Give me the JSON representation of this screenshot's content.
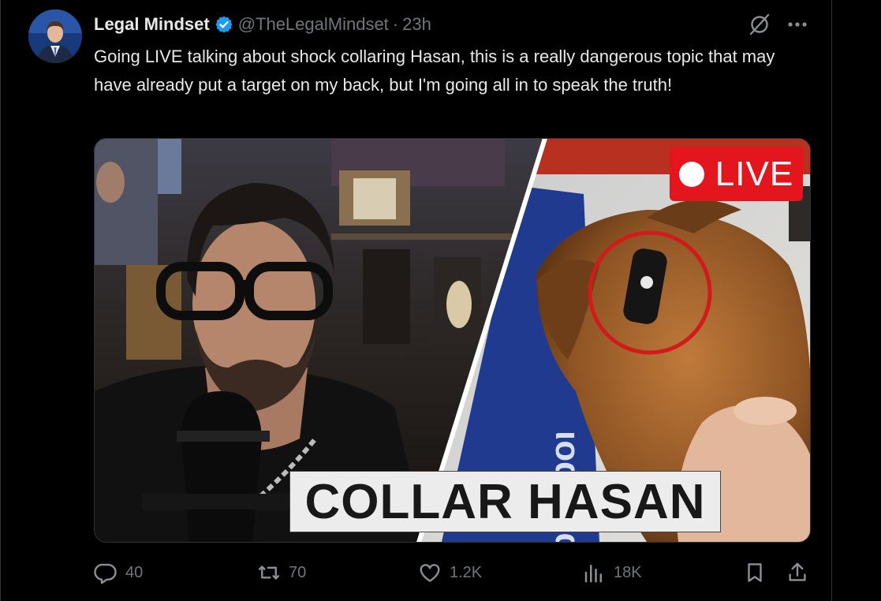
{
  "author": {
    "name": "Legal Mindset",
    "handle": "@TheLegalMindset",
    "separator": "·",
    "time": "23h",
    "verified": true
  },
  "icons": {
    "verified": "verified-badge-icon",
    "grok": "grok-icon",
    "more": "more-icon",
    "reply": "reply-icon",
    "repost": "repost-icon",
    "like": "like-icon",
    "views": "views-icon",
    "bookmark": "bookmark-icon",
    "share": "share-icon"
  },
  "tweet": {
    "text": "Going LIVE talking about shock collaring Hasan, this is a really dangerous topic that may have already put a target on my back, but I'm going all in to speak the truth!"
  },
  "media": {
    "live_label": "LIVE",
    "caption": "COLLAR HASAN",
    "banner_text": "ιοqƨɑlɑ"
  },
  "stats": {
    "replies": "40",
    "reposts": "70",
    "likes": "1.2K",
    "views": "18K"
  },
  "colors": {
    "background": "#000000",
    "text": "#e7e9ea",
    "muted": "#71767b",
    "verified": "#1d9bf0",
    "live_red": "#e3161d"
  }
}
